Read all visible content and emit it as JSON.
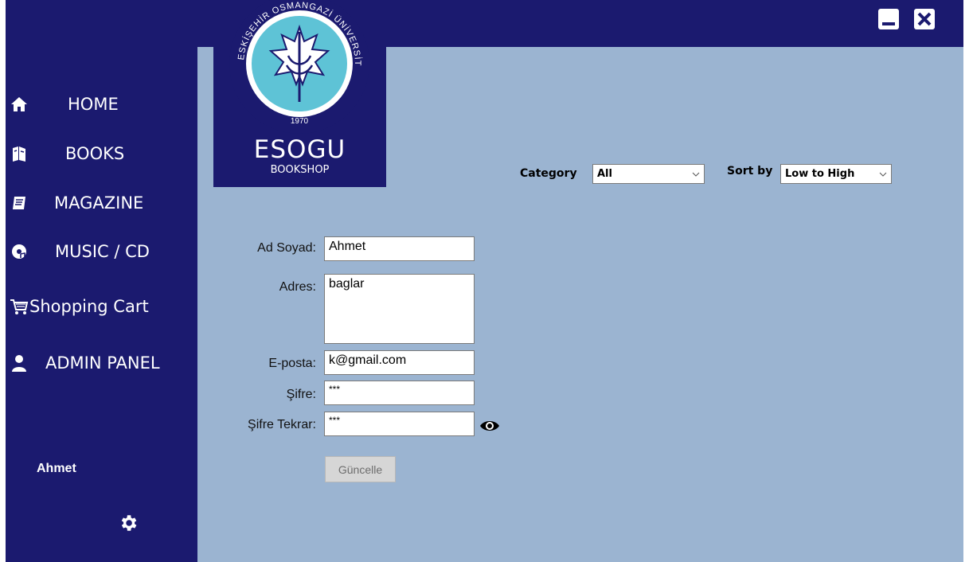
{
  "window": {
    "minimize_icon": "minimize-icon",
    "close_icon": "close-icon"
  },
  "brand": {
    "university_ring": "ESKİŞEHİR OSMANGAZİ ÜNİVERSİTESİ",
    "year": "1970",
    "name": "ESOGU",
    "subtitle": "BOOKSHOP"
  },
  "sidebar": {
    "items": [
      {
        "label": "HOME",
        "icon": "home-icon"
      },
      {
        "label": "BOOKS",
        "icon": "books-icon"
      },
      {
        "label": "MAGAZINE",
        "icon": "magazine-icon"
      },
      {
        "label": "MUSIC / CD",
        "icon": "music-cd-icon"
      },
      {
        "label": "Shopping Cart",
        "icon": "shopping-cart-icon"
      },
      {
        "label": "ADMIN PANEL",
        "icon": "user-icon"
      }
    ],
    "username": "Ahmet",
    "settings_icon": "gear-icon"
  },
  "filters": {
    "category_label": "Category",
    "category_value": "All",
    "sort_label": "Sort by",
    "sort_value": "Low to High"
  },
  "form": {
    "name_label": "Ad Soyad:",
    "name_value": "Ahmet",
    "address_label": "Adres:",
    "address_value": "baglar",
    "email_label": "E-posta:",
    "email_value": "k@gmail.com",
    "password_label": "Şifre:",
    "password_value": "***",
    "password_repeat_label": "Şifre Tekrar:",
    "password_repeat_value": "***",
    "show_password_icon": "eye-icon",
    "update_button": "Güncelle"
  },
  "colors": {
    "sidebar": "#1b1a6f",
    "content": "#9bb4d1",
    "logo_accent": "#5ec3d6"
  }
}
